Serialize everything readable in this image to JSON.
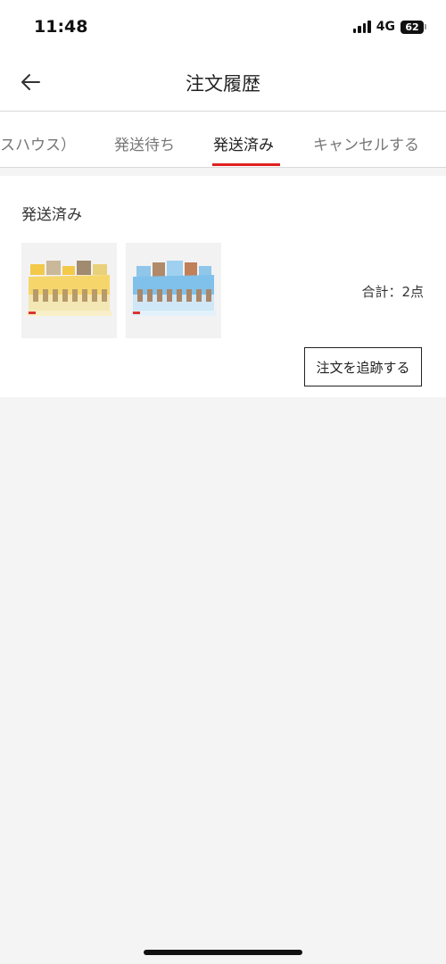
{
  "status_bar": {
    "time": "11:48",
    "network": "4G",
    "battery": "62"
  },
  "header": {
    "title": "注文履歴",
    "back_icon": "arrow-left-icon"
  },
  "tabs": [
    {
      "label": "スハウス）",
      "active": false
    },
    {
      "label": "発送待ち",
      "active": false
    },
    {
      "label": "発送済み",
      "active": true
    },
    {
      "label": "キャンセルする",
      "active": false
    }
  ],
  "order": {
    "status": "発送済み",
    "items": [
      {
        "theme": "yellow"
      },
      {
        "theme": "blue"
      }
    ],
    "total": "合計：2点",
    "track_button": "注文を追跡する"
  },
  "colors": {
    "accent": "#e02020",
    "background": "#f4f4f4",
    "card": "#ffffff"
  }
}
